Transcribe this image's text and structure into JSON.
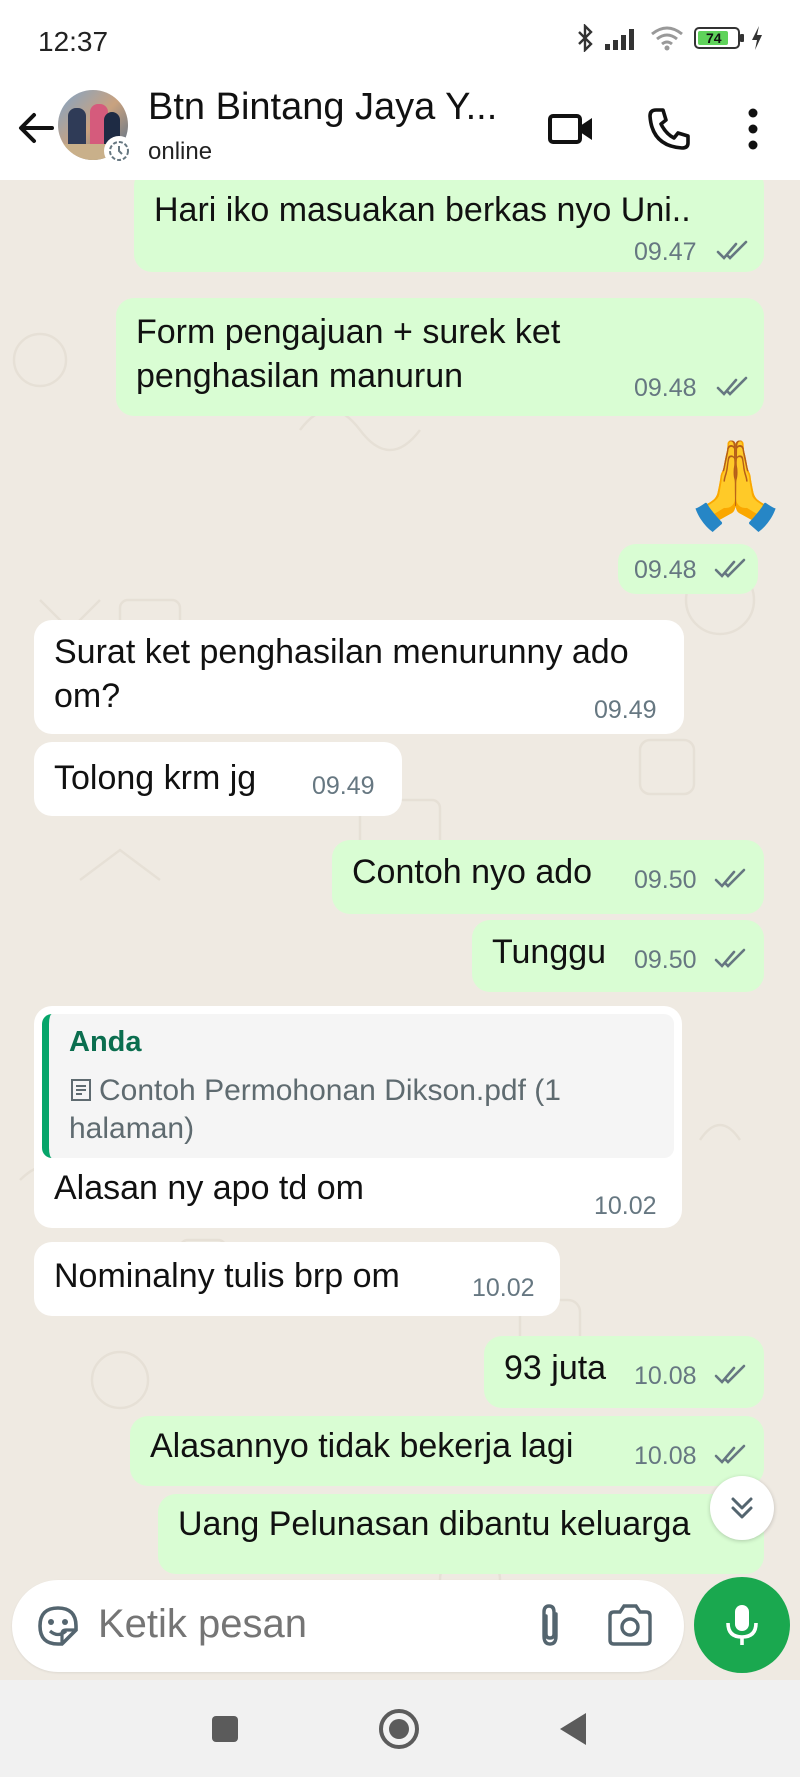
{
  "status_bar": {
    "time": "12:37",
    "battery": "74",
    "icons": [
      "bluetooth-icon",
      "signal-icon",
      "wifi-icon",
      "battery-icon",
      "charging-icon"
    ]
  },
  "header": {
    "contact_name": "Btn Bintang Jaya Y...",
    "status": "online",
    "icons": [
      "back-arrow-icon",
      "video-call-icon",
      "voice-call-icon",
      "more-vert-icon"
    ]
  },
  "messages": [
    {
      "dir": "out",
      "text": "Hari iko masuakan berkas nyo Uni..",
      "time": "09.47",
      "read": true
    },
    {
      "dir": "out",
      "text": "Form pengajuan + surek ket penghasilan manurun",
      "time": "09.48",
      "read": true
    },
    {
      "dir": "out",
      "emoji": "🙏",
      "time": "09.48",
      "read": true
    },
    {
      "dir": "in",
      "text": "Surat ket penghasilan menurunny ado om?",
      "time": "09.49"
    },
    {
      "dir": "in",
      "text": "Tolong krm jg",
      "time": "09.49"
    },
    {
      "dir": "out",
      "text": "Contoh nyo ado",
      "time": "09.50",
      "read": true
    },
    {
      "dir": "out",
      "text": "Tunggu",
      "time": "09.50",
      "read": true
    },
    {
      "dir": "in",
      "reply_author": "Anda",
      "reply_text": "Contoh Permohonan Dikson.pdf (1 halaman)",
      "text": "Alasan ny apo td om",
      "time": "10.02"
    },
    {
      "dir": "in",
      "text": "Nominalny tulis brp om",
      "time": "10.02"
    },
    {
      "dir": "out",
      "text": "93 juta",
      "time": "10.08",
      "read": true
    },
    {
      "dir": "out",
      "text": "Alasannyo tidak bekerja lagi",
      "time": "10.08",
      "read": true
    },
    {
      "dir": "out",
      "text": "Uang Pelunasan dibantu keluarga"
    }
  ],
  "composer": {
    "placeholder": "Ketik pesan",
    "icons": [
      "sticker-icon",
      "attach-icon",
      "camera-icon",
      "mic-icon"
    ]
  },
  "colors": {
    "outgoing_bubble": "#d9fdd3",
    "incoming_bubble": "#ffffff",
    "chat_background": "#efeae2",
    "accent": "#1aa84f",
    "read_ticks": "#53bdeb"
  }
}
